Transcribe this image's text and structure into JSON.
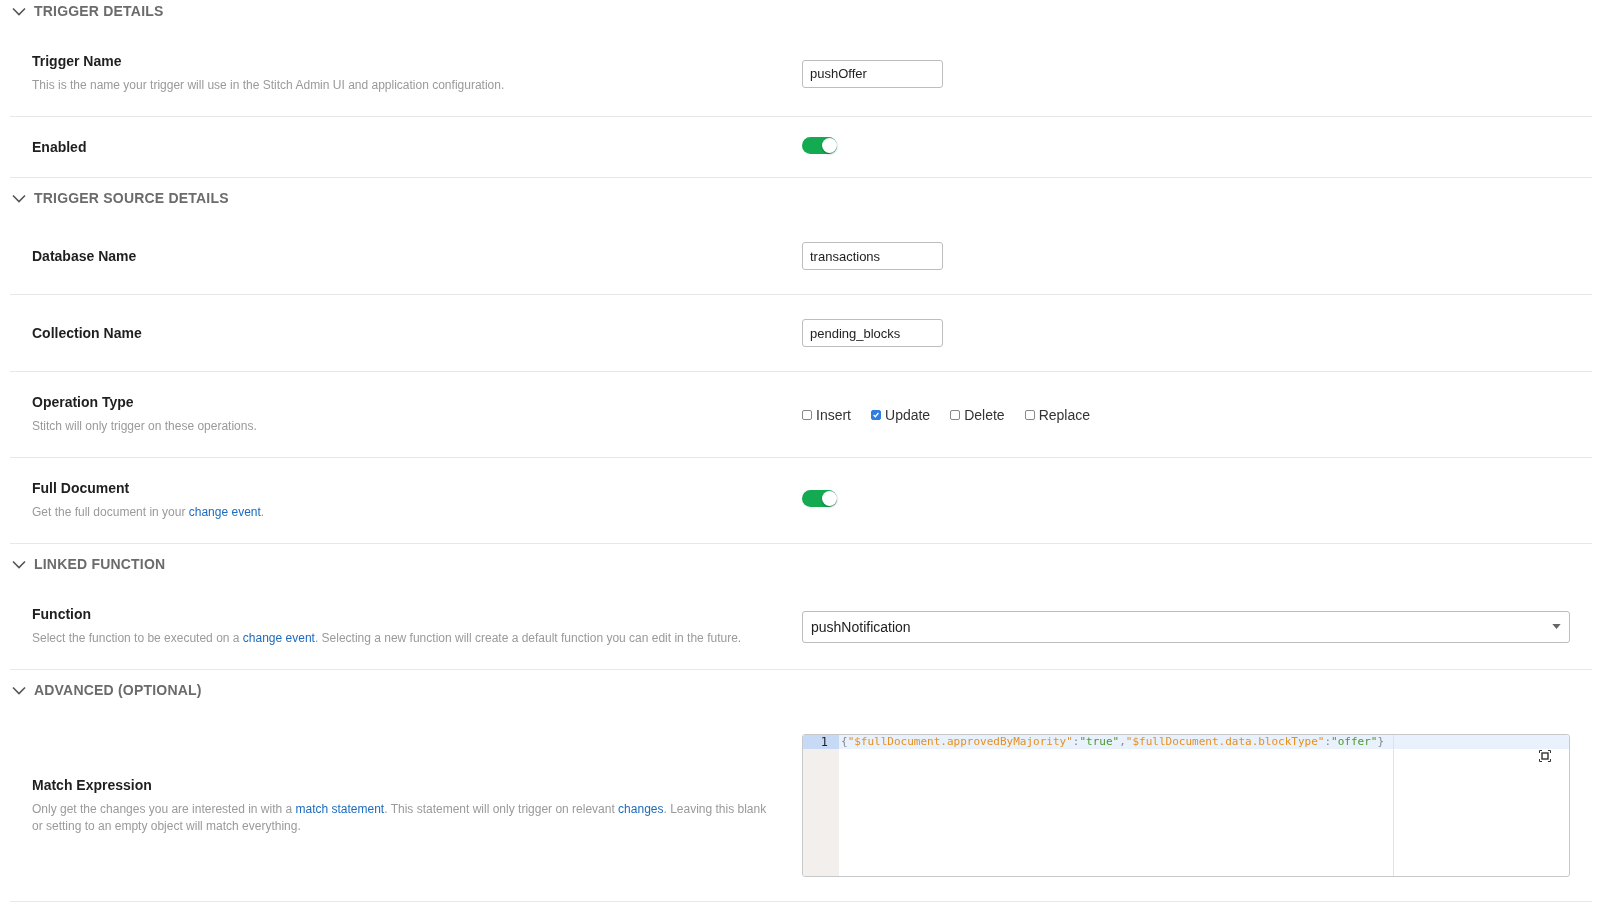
{
  "sections": [
    {
      "title": "TRIGGER DETAILS",
      "expanded": true,
      "rows": [
        {
          "label": "Trigger Name",
          "description": [
            {
              "text": "This is the name your trigger will use in the Stitch Admin UI and application configuration."
            }
          ],
          "control": {
            "kind": "text-field",
            "value": "pushOffer"
          }
        },
        {
          "label": "Enabled",
          "control": {
            "kind": "toggle",
            "on": true
          }
        }
      ]
    },
    {
      "title": "TRIGGER SOURCE DETAILS",
      "expanded": true,
      "rows": [
        {
          "label": "Database Name",
          "control": {
            "kind": "text-field",
            "value": "transactions"
          }
        },
        {
          "label": "Collection Name",
          "control": {
            "kind": "text-field",
            "value": "pending_blocks"
          }
        },
        {
          "label": "Operation Type",
          "description": [
            {
              "text": "Stitch will only trigger on these operations."
            }
          ],
          "control": {
            "kind": "checkboxes",
            "options": [
              {
                "label": "Insert",
                "checked": false
              },
              {
                "label": "Update",
                "checked": true
              },
              {
                "label": "Delete",
                "checked": false
              },
              {
                "label": "Replace",
                "checked": false
              }
            ]
          }
        },
        {
          "label": "Full Document",
          "description": [
            {
              "text": "Get the full document in your "
            },
            {
              "text": "change event",
              "kind": "link"
            },
            {
              "text": "."
            }
          ],
          "control": {
            "kind": "toggle",
            "on": true
          }
        }
      ]
    },
    {
      "title": "LINKED FUNCTION",
      "expanded": true,
      "rows": [
        {
          "label": "Function",
          "description": [
            {
              "text": "Select the function to be executed on a "
            },
            {
              "text": "change event",
              "kind": "link"
            },
            {
              "text": ". Selecting a new function will create a default function you can edit in the future."
            }
          ],
          "control": {
            "kind": "select",
            "value": "pushNotification"
          }
        }
      ]
    },
    {
      "title": "ADVANCED (OPTIONAL)",
      "expanded": true,
      "rows": [
        {
          "label": "Match Expression",
          "description": [
            {
              "text": "Only get the changes you are interested in with a "
            },
            {
              "text": "match statement",
              "kind": "link"
            },
            {
              "text": ". This statement will only trigger on relevant "
            },
            {
              "text": "changes",
              "kind": "link"
            },
            {
              "text": ". Leaving this blank or setting to an empty object will match everything."
            }
          ],
          "control": {
            "kind": "code-editor",
            "line_number": "1",
            "tokens": [
              {
                "kind": "punct",
                "text": "{"
              },
              {
                "kind": "key",
                "text": "\"$fullDocument.approvedByMajority\""
              },
              {
                "kind": "punct",
                "text": ":"
              },
              {
                "kind": "string",
                "text": "\"true\""
              },
              {
                "kind": "punct",
                "text": ","
              },
              {
                "kind": "key",
                "text": "\"$fullDocument.data.blockType\""
              },
              {
                "kind": "punct",
                "text": ":"
              },
              {
                "kind": "string",
                "text": "\"offer\""
              },
              {
                "kind": "punct",
                "text": "}"
              }
            ]
          }
        }
      ]
    }
  ]
}
